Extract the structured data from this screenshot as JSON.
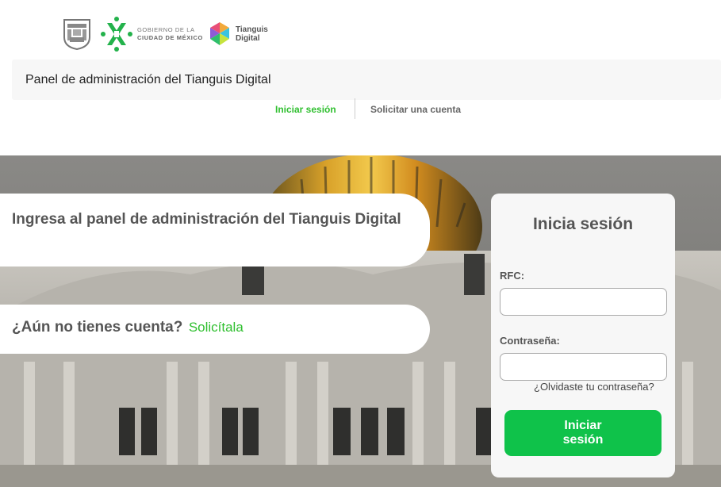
{
  "header": {
    "logos": {
      "shield_icon": "cdmx-shield-icon",
      "mark_icon": "cdmx-x-logo-icon",
      "gobierno_line1": "GOBIERNO DE LA",
      "gobierno_line2": "CIUDAD DE MÉXICO",
      "tianguis_icon": "tianguis-digital-logo-icon",
      "tianguis_line1": "Tianguis",
      "tianguis_line2": "Digital"
    },
    "panel_title": "Panel de administración del Tianguis Digital"
  },
  "tabs": [
    {
      "label": "Iniciar sesión",
      "active": true
    },
    {
      "label": "Solicitar una cuenta",
      "active": false
    }
  ],
  "hero": {
    "headline": "Ingresa al panel de administración del Tianguis Digital",
    "no_account_question": "¿Aún no tienes cuenta?",
    "request_link": "Solicítala"
  },
  "login": {
    "title": "Inicia sesión",
    "rfc_label": "RFC:",
    "rfc_value": "",
    "password_label": "Contraseña:",
    "password_value": "",
    "forgot_link": "¿Olvidaste tu contraseña?",
    "submit_label": "Iniciar sesión"
  },
  "colors": {
    "accent_green": "#0fc24a",
    "link_green": "#2fbf2f",
    "text_gray": "#555555"
  }
}
